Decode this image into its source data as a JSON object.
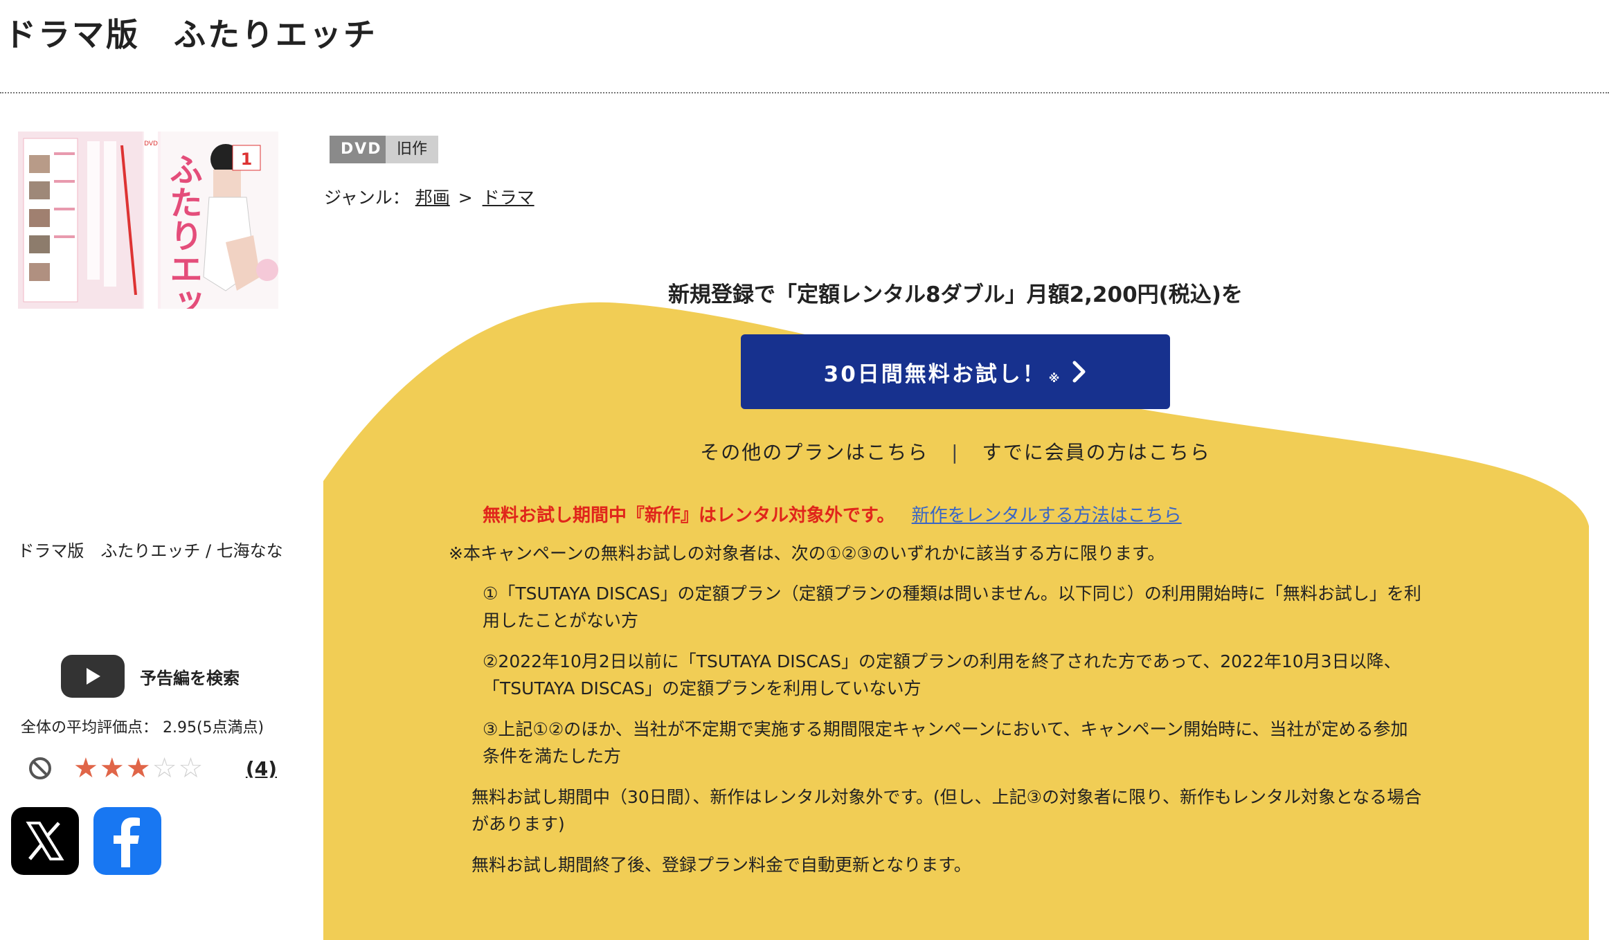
{
  "title": "ドラマ版　ふたりエッチ",
  "badges": {
    "format": "DVD",
    "release": "旧作"
  },
  "genre": {
    "label": "ジャンル：",
    "category": "邦画",
    "separator": ">",
    "subcategory": "ドラマ"
  },
  "caption": "ドラマ版　ふたりエッチ / 七海なな",
  "trailer": {
    "label": "予告編を検索"
  },
  "rating": {
    "avg_text": "全体の平均評価点： 2.95(5点満点)",
    "stars_filled": 3,
    "stars_total": 5,
    "count": "(4)"
  },
  "promo": {
    "heading": "新規登録で「定額レンタル8ダブル」月額2,200円(税込)を",
    "cta_label": "30日間無料お試し！",
    "cta_mark": "※",
    "other_plans": "その他のプランはこちら",
    "divider": "|",
    "member_login": "すでに会員の方はこちら",
    "notice_red": "無料お試し期間中『新作』はレンタル対象外です。",
    "notice_link": "新作をレンタルする方法はこちら"
  },
  "terms": {
    "intro": "※本キャンペーンの無料お試しの対象者は、次の①②③のいずれかに該当する方に限ります。",
    "items": [
      {
        "line1": "①「TSUTAYA DISCAS」の定額プラン（定額プランの種類は問いません。以下同じ）の利用開始時に「無料お試し」を利",
        "line2": "用したことがない方"
      },
      {
        "line1": "②2022年10月2日以前に「TSUTAYA DISCAS」の定額プランの利用を終了された方であって、2022年10月3日以降、",
        "line2": "「TSUTAYA DISCAS」の定額プランを利用していない方"
      },
      {
        "line1": "③上記①②のほか、当社が不定期で実施する期間限定キャンペーンにおいて、キャンペーン開始時に、当社が定める参加",
        "line2": "条件を満たした方"
      }
    ],
    "note1_line1": "無料お試し期間中（30日間）、新作はレンタル対象外です。(但し、上記③の対象者に限り、新作もレンタル対象となる場合",
    "note1_line2": "があります)",
    "note2": "無料お試し期間終了後、登録プラン料金で自動更新となります。"
  },
  "colors": {
    "promo_bg": "#f1cd55",
    "cta": "#17318e",
    "notice_red": "#e0251b",
    "link_blue": "#3a66c4"
  }
}
